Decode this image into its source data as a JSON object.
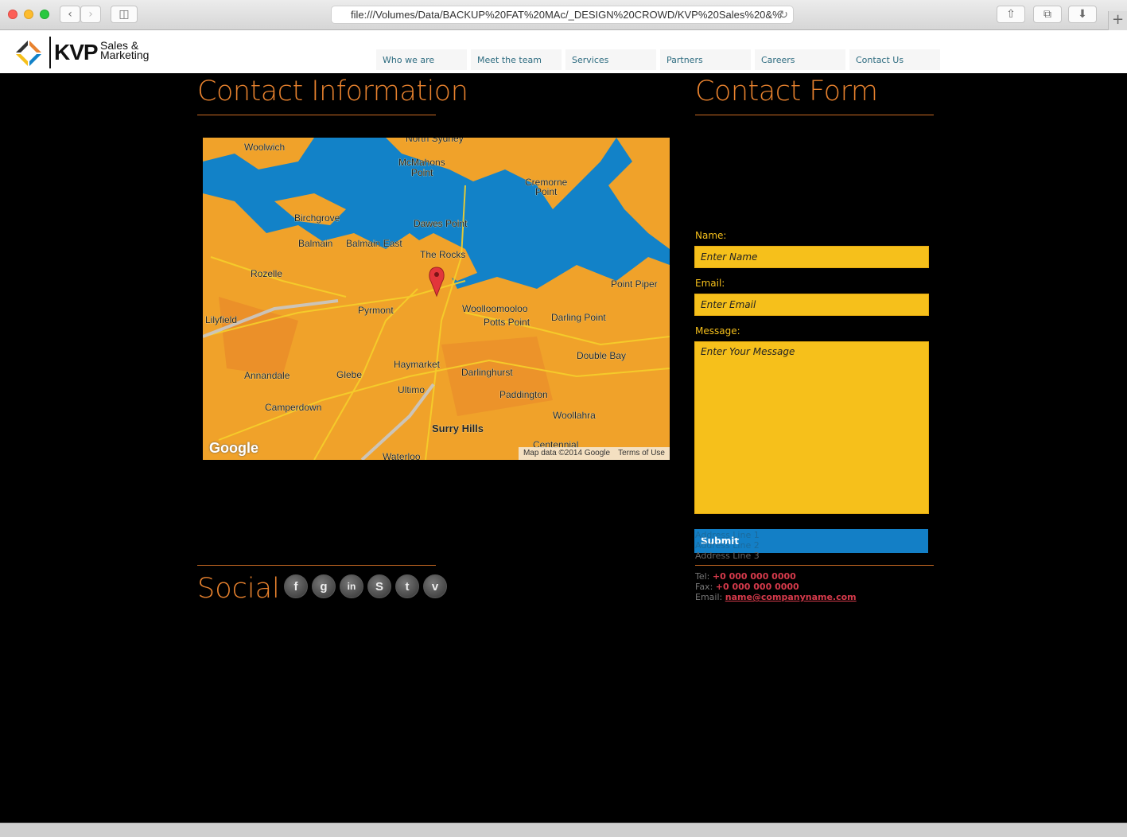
{
  "browser": {
    "url": "file:///Volumes/Data/BACKUP%20FAT%20MAc/_DESIGN%20CROWD/KVP%20Sales%20&%"
  },
  "logo": {
    "main": "KVP",
    "sub_line1": "Sales &",
    "sub_line2": "Marketing"
  },
  "nav": {
    "items": [
      "Who we are",
      "Meet the team",
      "Services",
      "Partners",
      "Careers",
      "Contact Us"
    ]
  },
  "contact_info": {
    "title": "Contact Information"
  },
  "map": {
    "brand": "Google",
    "attribution": "Map data ©2014 Google",
    "terms": "Terms of Use",
    "labels": [
      "Woolwich",
      "North Sydney",
      "McMahons Point",
      "Cremorne Point",
      "Birchgrove",
      "Dawes Point",
      "Balmain",
      "Balmain East",
      "The Rocks",
      "Rozelle",
      "Point Piper",
      "Pyrmont",
      "Woolloomooloo",
      "Lilyfield",
      "Potts Point",
      "Darling Point",
      "Double Bay",
      "Haymarket",
      "Darlinghurst",
      "Annandale",
      "Glebe",
      "Ultimo",
      "Paddington",
      "Woollahra",
      "Camperdown",
      "Surry Hills",
      "Centennial",
      "Waterloo"
    ],
    "colors": {
      "water": "#1282c8",
      "land": "#f0a22a",
      "roads": "#f6d02a"
    }
  },
  "social": {
    "title": "Social",
    "icons": [
      {
        "name": "facebook-icon",
        "glyph": "f"
      },
      {
        "name": "google-plus-icon",
        "glyph": "g"
      },
      {
        "name": "linkedin-icon",
        "glyph": "in"
      },
      {
        "name": "skype-icon",
        "glyph": "S"
      },
      {
        "name": "twitter-icon",
        "glyph": "t"
      },
      {
        "name": "vimeo-icon",
        "glyph": "v"
      }
    ]
  },
  "contact_form": {
    "title": "Contact Form",
    "name_label": "Name:",
    "name_placeholder": "Enter Name",
    "email_label": "Email:",
    "email_placeholder": "Enter Email",
    "message_label": "Message:",
    "message_placeholder": "Enter Your Message",
    "submit_label": "Submit"
  },
  "address": {
    "line1": "Address Line 1",
    "line2": "Address Line 2",
    "line3": "Address Line 3",
    "tel_label": "Tel:",
    "tel": "+0 000 000 0000",
    "fax_label": "Fax:",
    "fax": "+0 000 000 0000",
    "email_label": "Email:",
    "email": "name@companyname.com"
  },
  "colors": {
    "accent": "#e8822e",
    "form_field": "#f6c01b",
    "submit": "#137fc6",
    "link": "#d63a4b"
  }
}
